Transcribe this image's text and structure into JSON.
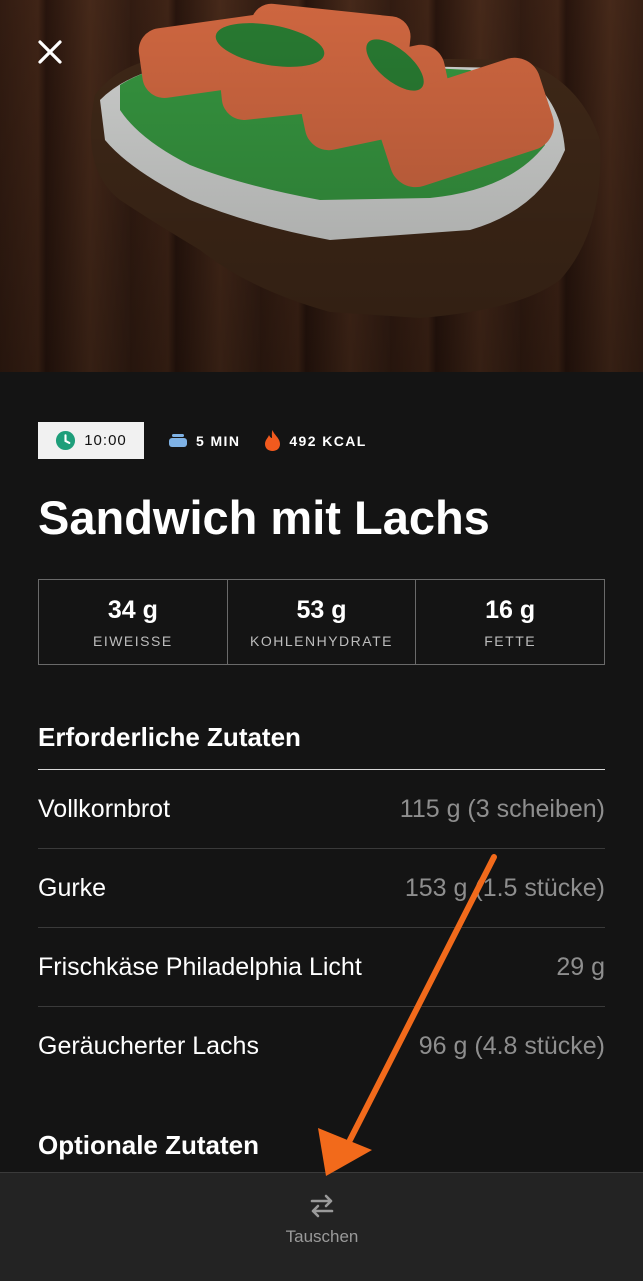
{
  "recipe": {
    "time": "10:00",
    "duration": "5 MIN",
    "calories": "492 KCAL",
    "title": "Sandwich mit Lachs"
  },
  "macros": [
    {
      "value": "34 g",
      "label": "EIWEISSE"
    },
    {
      "value": "53 g",
      "label": "KOHLENHYDRATE"
    },
    {
      "value": "16 g",
      "label": "FETTE"
    }
  ],
  "required_section": {
    "title": "Erforderliche Zutaten",
    "items": [
      {
        "name": "Vollkornbrot",
        "amount": "115 g (3 scheiben)"
      },
      {
        "name": "Gurke",
        "amount": "153 g (1.5 stücke)"
      },
      {
        "name": "Frischkäse Philadelphia Licht",
        "amount": "29 g"
      },
      {
        "name": "Geräucherter Lachs",
        "amount": "96 g (4.8 stücke)"
      }
    ]
  },
  "optional_section": {
    "title": "Optionale Zutaten"
  },
  "bottom_bar": {
    "swap_label": "Tauschen"
  },
  "colors": {
    "background": "#141414",
    "annotation_arrow": "#f26a1b",
    "clock": "#1e9e7a",
    "pot": "#7fb2e5",
    "flame": "#f25a1e"
  },
  "icons": [
    "close-icon",
    "clock-icon",
    "pot-icon",
    "flame-icon",
    "swap-icon"
  ]
}
